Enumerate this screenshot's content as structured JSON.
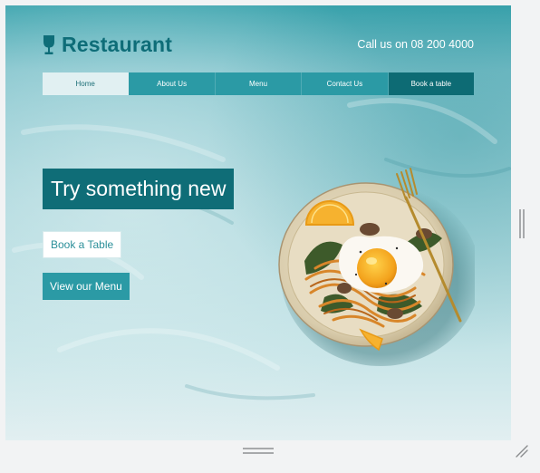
{
  "brand": {
    "title": "Restaurant",
    "icon": "wine-glass-icon",
    "color": "#0e6d78"
  },
  "header": {
    "phone_text": "Call us on 08 200 4000"
  },
  "nav": {
    "items": [
      {
        "label": "Home",
        "active": true
      },
      {
        "label": "About Us"
      },
      {
        "label": "Menu"
      },
      {
        "label": "Contact Us"
      },
      {
        "label": "Book a table",
        "highlight": true
      }
    ]
  },
  "hero": {
    "headline": "Try something new",
    "primary_button": "Book a Table",
    "secondary_button": "View our Menu",
    "image": "food-plate-photo"
  },
  "colors": {
    "teal_dark": "#0f6d77",
    "teal": "#2b9aa5",
    "teal_light": "#e1f0f2",
    "background": "#7fc3cd"
  },
  "window": {
    "icons": [
      "vertical-scrollbar-grip-icon",
      "horizontal-scrollbar-grip-icon",
      "resize-corner-icon"
    ]
  }
}
